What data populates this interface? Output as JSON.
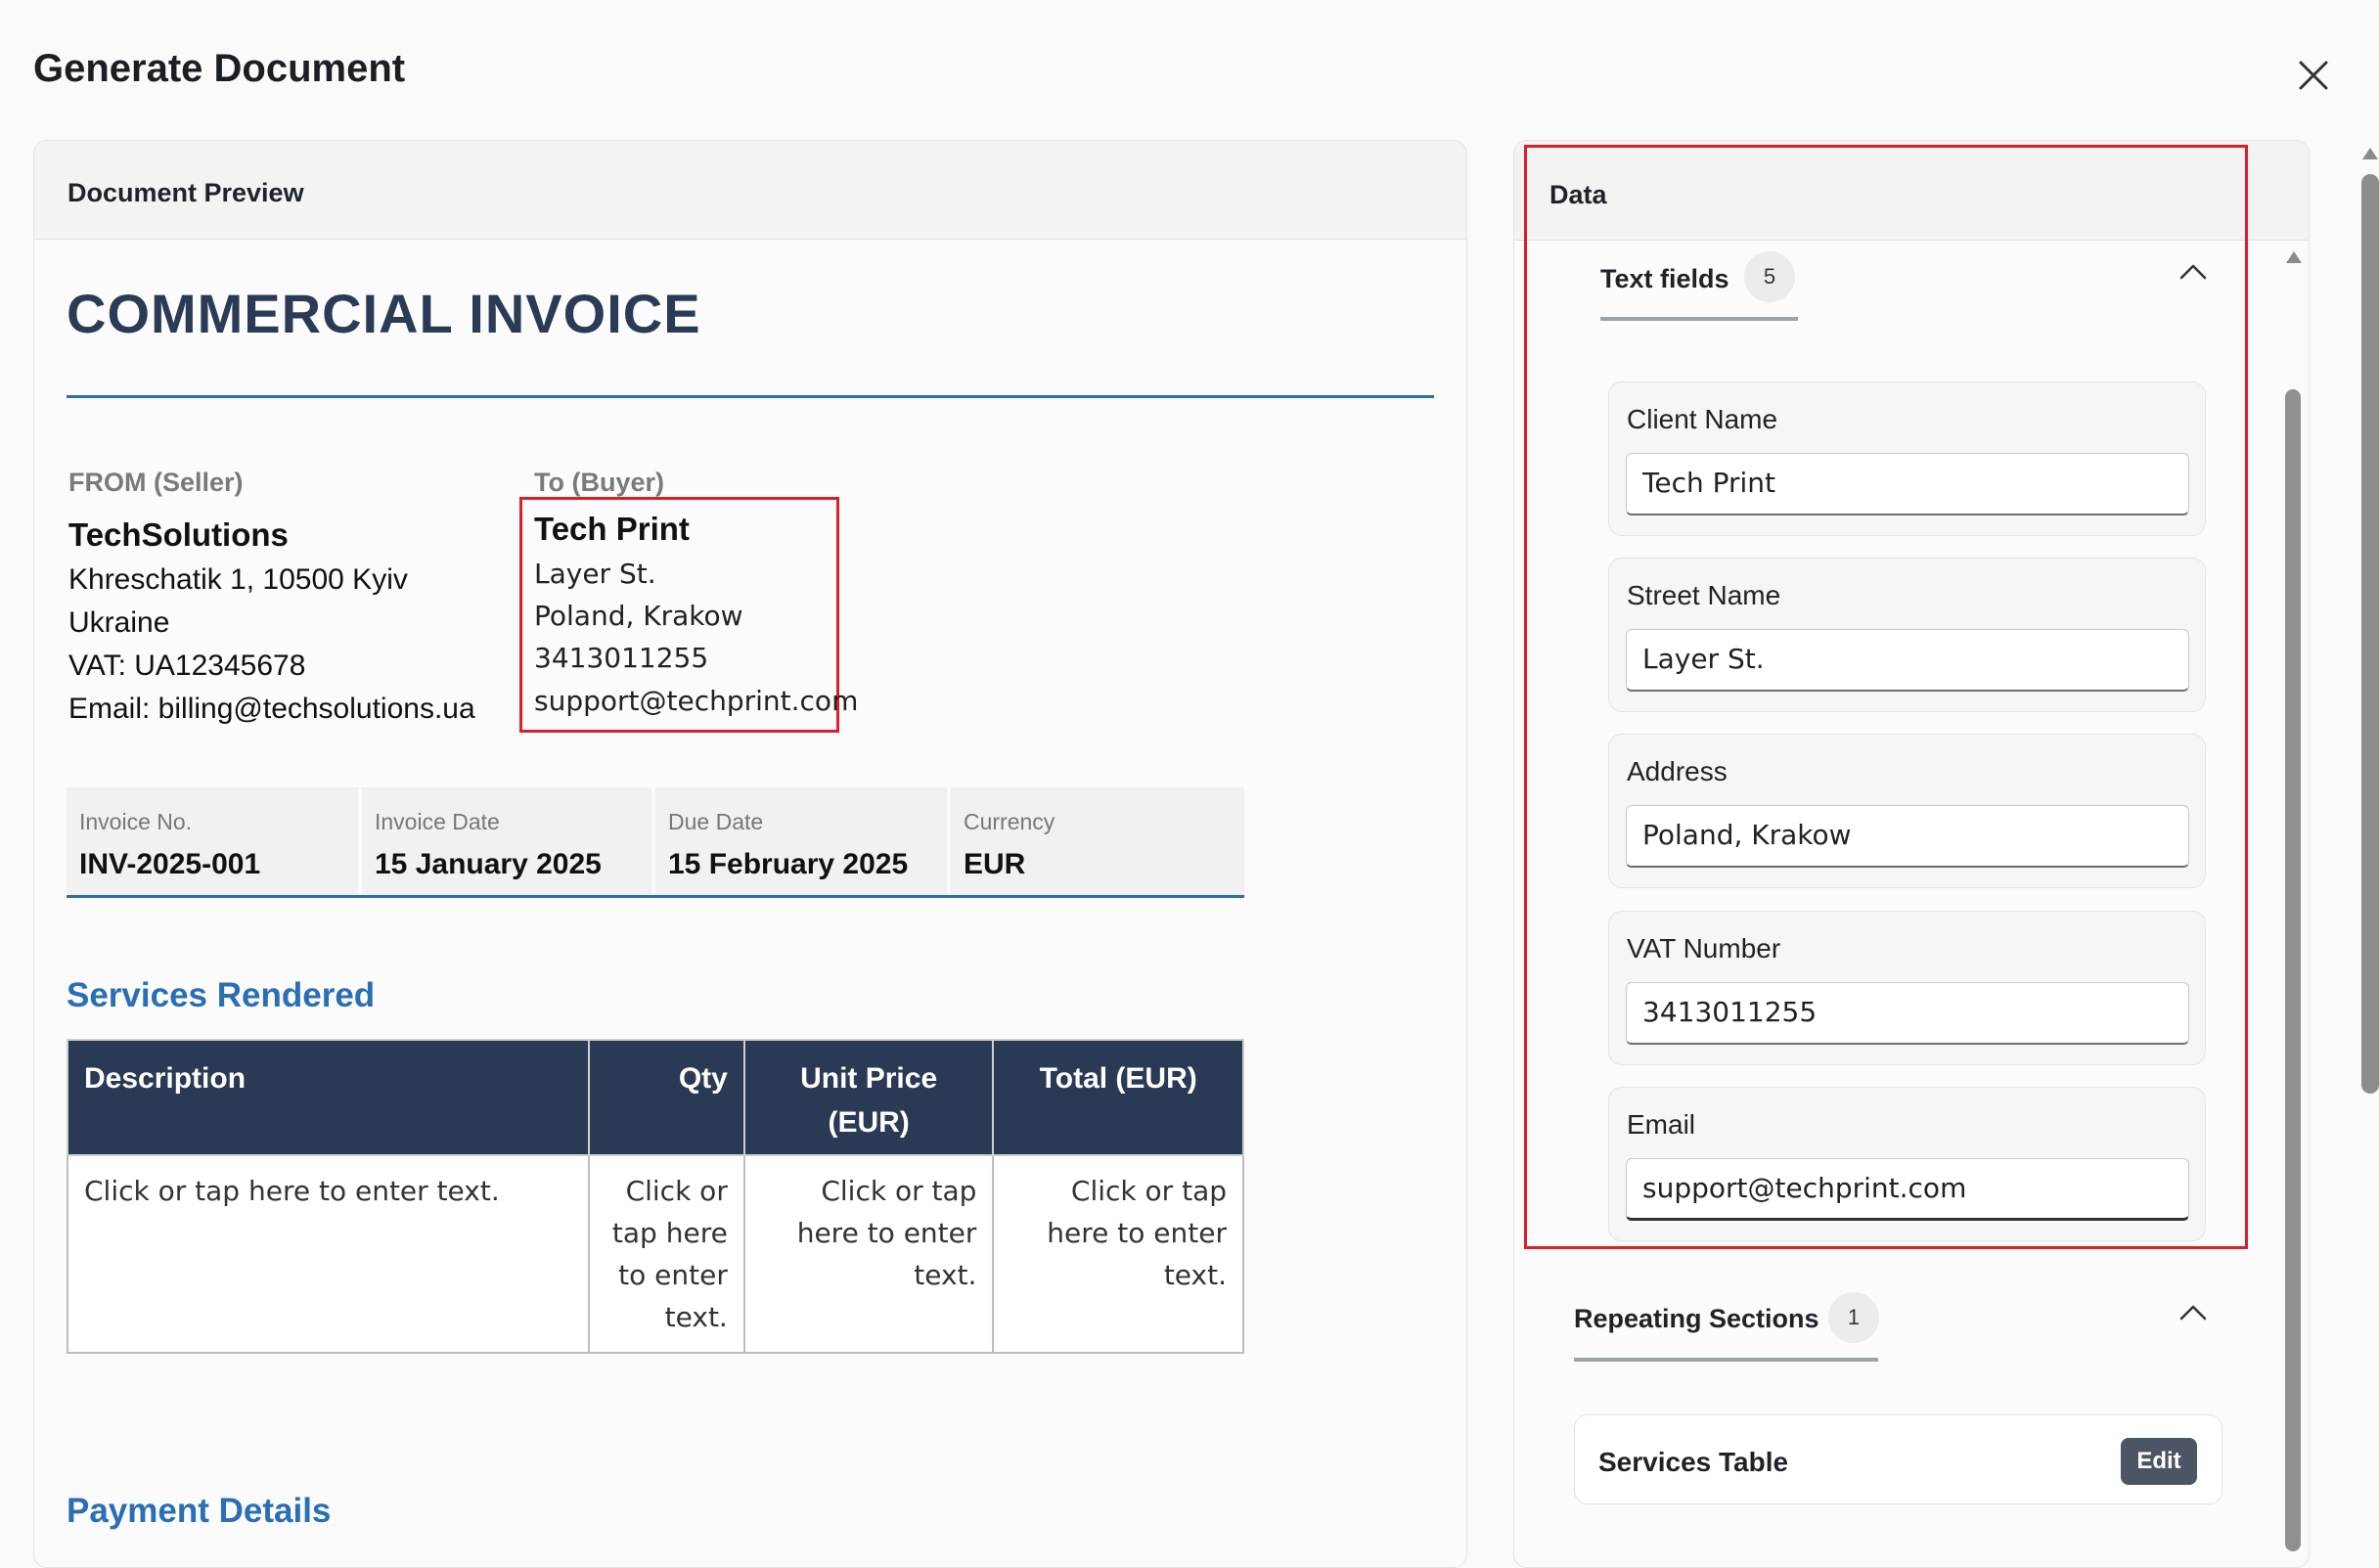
{
  "dialog": {
    "title": "Generate Document",
    "close_icon": "close-icon"
  },
  "preview": {
    "header": "Document Preview",
    "invoice_title": "COMMERCIAL INVOICE",
    "from_label": "FROM (Seller)",
    "to_label": "To (Buyer)",
    "seller": {
      "name": "TechSolutions",
      "lines": [
        "Khreschatik 1, 10500 Kyiv",
        "Ukraine",
        "VAT: UA12345678",
        "Email: billing@techsolutions.ua"
      ]
    },
    "buyer": {
      "name": "Tech Print",
      "lines": [
        "Layer St.",
        "Poland, Krakow",
        "3413011255",
        "support@techprint.com"
      ]
    },
    "meta": [
      {
        "label": "Invoice No.",
        "value": "INV-2025-001"
      },
      {
        "label": "Invoice Date",
        "value": "15 January 2025"
      },
      {
        "label": "Due Date",
        "value": "15 February 2025"
      },
      {
        "label": "Currency",
        "value": "EUR"
      }
    ],
    "services_heading": "Services Rendered",
    "table": {
      "headers": [
        "Description",
        "Qty",
        "Unit Price (EUR)",
        "Total (EUR)"
      ],
      "row": [
        "Click or tap here to enter text.",
        "Click or tap here to enter text.",
        "Click or tap here to enter text.",
        "Click or tap here to enter text."
      ]
    },
    "payment_heading": "Payment Details"
  },
  "data_panel": {
    "header": "Data",
    "text_fields_section": {
      "title": "Text fields",
      "count": "5"
    },
    "fields": [
      {
        "label": "Client Name",
        "value": "Tech Print"
      },
      {
        "label": "Street Name",
        "value": "Layer St."
      },
      {
        "label": "Address",
        "value": "Poland, Krakow"
      },
      {
        "label": "VAT Number",
        "value": "3413011255"
      },
      {
        "label": "Email",
        "value": "support@techprint.com"
      }
    ],
    "repeating_section": {
      "title": "Repeating Sections",
      "count": "1"
    },
    "services_table_card": {
      "label": "Services Table",
      "edit_label": "Edit"
    }
  },
  "colors": {
    "highlight": "#d9202a",
    "accent_blue": "#2a6fb5",
    "table_header": "#2a3a55"
  }
}
